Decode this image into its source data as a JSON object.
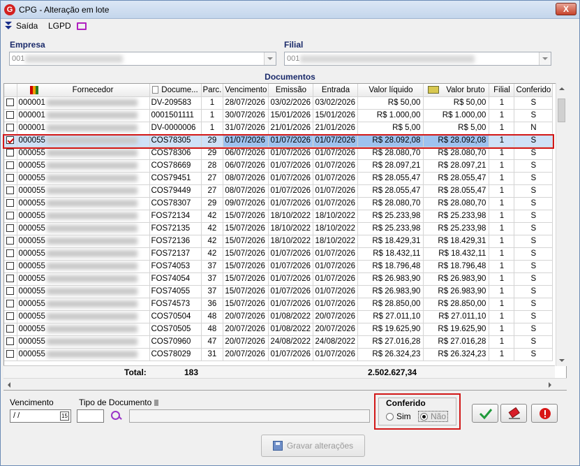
{
  "window": {
    "title": "CPG - Alteração em lote",
    "close_label": "X"
  },
  "menu": {
    "saida": "Saída",
    "lgpd": "LGPD"
  },
  "empresa": {
    "label": "Empresa",
    "value": "001"
  },
  "filial": {
    "label": "Filial",
    "value": "001"
  },
  "grid": {
    "title": "Documentos",
    "columns": [
      "Fornecedor",
      "Docume...",
      "Parc.",
      "Vencimento",
      "Emissão",
      "Entrada",
      "Valor líquido",
      "Valor bruto",
      "Filial",
      "Conferido"
    ],
    "rows": [
      {
        "checked": false,
        "forn": "000001",
        "doc": "DV-209583",
        "parc": "1",
        "venc": "28/07/2026",
        "emis": "03/02/2026",
        "ent": "03/02/2026",
        "liq": "R$ 50,00",
        "bruto": "R$ 50,00",
        "filial": "1",
        "conf": "S"
      },
      {
        "checked": false,
        "forn": "000001",
        "doc": "0001501111",
        "parc": "1",
        "venc": "30/07/2026",
        "emis": "15/01/2026",
        "ent": "15/01/2026",
        "liq": "R$ 1.000,00",
        "bruto": "R$ 1.000,00",
        "filial": "1",
        "conf": "S"
      },
      {
        "checked": false,
        "forn": "000001",
        "doc": "DV-0000006",
        "parc": "1",
        "venc": "31/07/2026",
        "emis": "21/01/2026",
        "ent": "21/01/2026",
        "liq": "R$ 5,00",
        "bruto": "R$ 5,00",
        "filial": "1",
        "conf": "N"
      },
      {
        "checked": true,
        "forn": "000055",
        "doc": "COS78305",
        "parc": "29",
        "venc": "01/07/2026",
        "emis": "01/07/2026",
        "ent": "01/07/2026",
        "liq": "R$ 28.092,08",
        "bruto": "R$ 28.092,08",
        "filial": "1",
        "conf": "S"
      },
      {
        "checked": false,
        "forn": "000055",
        "doc": "COS78306",
        "parc": "29",
        "venc": "06/07/2026",
        "emis": "01/07/2026",
        "ent": "01/07/2026",
        "liq": "R$ 28.080,70",
        "bruto": "R$ 28.080,70",
        "filial": "1",
        "conf": "S"
      },
      {
        "checked": false,
        "forn": "000055",
        "doc": "COS78669",
        "parc": "28",
        "venc": "06/07/2026",
        "emis": "01/07/2026",
        "ent": "01/07/2026",
        "liq": "R$ 28.097,21",
        "bruto": "R$ 28.097,21",
        "filial": "1",
        "conf": "S"
      },
      {
        "checked": false,
        "forn": "000055",
        "doc": "COS79451",
        "parc": "27",
        "venc": "08/07/2026",
        "emis": "01/07/2026",
        "ent": "01/07/2026",
        "liq": "R$ 28.055,47",
        "bruto": "R$ 28.055,47",
        "filial": "1",
        "conf": "S"
      },
      {
        "checked": false,
        "forn": "000055",
        "doc": "COS79449",
        "parc": "27",
        "venc": "08/07/2026",
        "emis": "01/07/2026",
        "ent": "01/07/2026",
        "liq": "R$ 28.055,47",
        "bruto": "R$ 28.055,47",
        "filial": "1",
        "conf": "S"
      },
      {
        "checked": false,
        "forn": "000055",
        "doc": "COS78307",
        "parc": "29",
        "venc": "09/07/2026",
        "emis": "01/07/2026",
        "ent": "01/07/2026",
        "liq": "R$ 28.080,70",
        "bruto": "R$ 28.080,70",
        "filial": "1",
        "conf": "S"
      },
      {
        "checked": false,
        "forn": "000055",
        "doc": "FOS72134",
        "parc": "42",
        "venc": "15/07/2026",
        "emis": "18/10/2022",
        "ent": "18/10/2022",
        "liq": "R$ 25.233,98",
        "bruto": "R$ 25.233,98",
        "filial": "1",
        "conf": "S"
      },
      {
        "checked": false,
        "forn": "000055",
        "doc": "FOS72135",
        "parc": "42",
        "venc": "15/07/2026",
        "emis": "18/10/2022",
        "ent": "18/10/2022",
        "liq": "R$ 25.233,98",
        "bruto": "R$ 25.233,98",
        "filial": "1",
        "conf": "S"
      },
      {
        "checked": false,
        "forn": "000055",
        "doc": "FOS72136",
        "parc": "42",
        "venc": "15/07/2026",
        "emis": "18/10/2022",
        "ent": "18/10/2022",
        "liq": "R$ 18.429,31",
        "bruto": "R$ 18.429,31",
        "filial": "1",
        "conf": "S"
      },
      {
        "checked": false,
        "forn": "000055",
        "doc": "FOS72137",
        "parc": "42",
        "venc": "15/07/2026",
        "emis": "01/07/2026",
        "ent": "01/07/2026",
        "liq": "R$ 18.432,11",
        "bruto": "R$ 18.432,11",
        "filial": "1",
        "conf": "S"
      },
      {
        "checked": false,
        "forn": "000055",
        "doc": "FOS74053",
        "parc": "37",
        "venc": "15/07/2026",
        "emis": "01/07/2026",
        "ent": "01/07/2026",
        "liq": "R$ 18.796,48",
        "bruto": "R$ 18.796,48",
        "filial": "1",
        "conf": "S"
      },
      {
        "checked": false,
        "forn": "000055",
        "doc": "FOS74054",
        "parc": "37",
        "venc": "15/07/2026",
        "emis": "01/07/2026",
        "ent": "01/07/2026",
        "liq": "R$ 26.983,90",
        "bruto": "R$ 26.983,90",
        "filial": "1",
        "conf": "S"
      },
      {
        "checked": false,
        "forn": "000055",
        "doc": "FOS74055",
        "parc": "37",
        "venc": "15/07/2026",
        "emis": "01/07/2026",
        "ent": "01/07/2026",
        "liq": "R$ 26.983,90",
        "bruto": "R$ 26.983,90",
        "filial": "1",
        "conf": "S"
      },
      {
        "checked": false,
        "forn": "000055",
        "doc": "FOS74573",
        "parc": "36",
        "venc": "15/07/2026",
        "emis": "01/07/2026",
        "ent": "01/07/2026",
        "liq": "R$ 28.850,00",
        "bruto": "R$ 28.850,00",
        "filial": "1",
        "conf": "S"
      },
      {
        "checked": false,
        "forn": "000055",
        "doc": "COS70504",
        "parc": "48",
        "venc": "20/07/2026",
        "emis": "01/08/2022",
        "ent": "20/07/2026",
        "liq": "R$ 27.011,10",
        "bruto": "R$ 27.011,10",
        "filial": "1",
        "conf": "S"
      },
      {
        "checked": false,
        "forn": "000055",
        "doc": "COS70505",
        "parc": "48",
        "venc": "20/07/2026",
        "emis": "01/08/2022",
        "ent": "20/07/2026",
        "liq": "R$ 19.625,90",
        "bruto": "R$ 19.625,90",
        "filial": "1",
        "conf": "S"
      },
      {
        "checked": false,
        "forn": "000055",
        "doc": "COS70960",
        "parc": "47",
        "venc": "20/07/2026",
        "emis": "24/08/2022",
        "ent": "24/08/2022",
        "liq": "R$ 27.016,28",
        "bruto": "R$ 27.016,28",
        "filial": "1",
        "conf": "S"
      },
      {
        "checked": false,
        "forn": "000055",
        "doc": "COS78029",
        "parc": "31",
        "venc": "20/07/2026",
        "emis": "01/07/2026",
        "ent": "01/07/2026",
        "liq": "R$ 26.324,23",
        "bruto": "R$ 26.324,23",
        "filial": "1",
        "conf": "S"
      }
    ],
    "total_label": "Total:",
    "total_count": "183",
    "total_value": "2.502.627,34"
  },
  "filters": {
    "vencimento_label": "Vencimento",
    "vencimento_value": "/ /",
    "tipo_label": "Tipo de Documento",
    "calendar_label": "15"
  },
  "conferido": {
    "title": "Conferido",
    "sim": "Sim",
    "nao": "Não",
    "selected": "Não"
  },
  "actions": {
    "save": "Gravar alterações"
  },
  "colors": {
    "selected_row": "#cfe1f7",
    "highlight": "#d21818"
  }
}
